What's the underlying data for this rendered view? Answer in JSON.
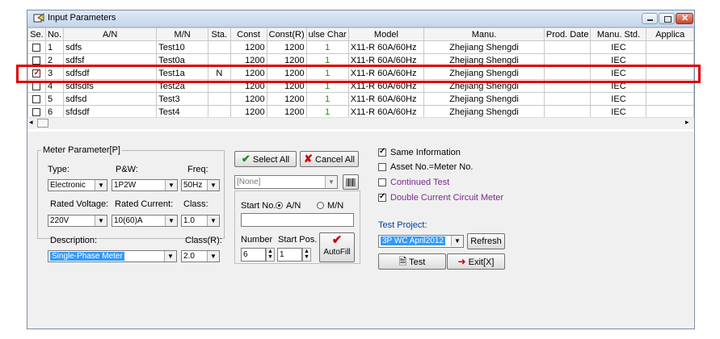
{
  "window": {
    "title": "Input Parameters"
  },
  "grid": {
    "headers": [
      "Se.",
      "No.",
      "A/N",
      "M/N",
      "Sta.",
      "Const",
      "Const(R)",
      "ulse Char",
      "Model",
      "Manu.",
      "Prod. Date",
      "Manu. Std.",
      "Applica"
    ],
    "rows": [
      {
        "checked": false,
        "no": "1",
        "an": "sdfs",
        "mn": "Test10",
        "sta": "",
        "const": "1200",
        "constr": "1200",
        "pulse": "1",
        "model": "X11-R 60A/60Hz",
        "manu": "Zhejiang Shengdi",
        "prod": "",
        "std": "IEC",
        "app": ""
      },
      {
        "checked": false,
        "no": "2",
        "an": "sdfsf",
        "mn": "Test0a",
        "sta": "",
        "const": "1200",
        "constr": "1200",
        "pulse": "1",
        "model": "X11-R 60A/60Hz",
        "manu": "Zhejiang Shengdi",
        "prod": "",
        "std": "IEC",
        "app": ""
      },
      {
        "checked": true,
        "no": "3",
        "an": "sdfsdf",
        "mn": "Test1a",
        "sta": "N",
        "const": "1200",
        "constr": "1200",
        "pulse": "1",
        "model": "X11-R 60A/60Hz",
        "manu": "Zhejiang Shengdi",
        "prod": "",
        "std": "IEC",
        "app": ""
      },
      {
        "checked": false,
        "no": "4",
        "an": "sdfsdfs",
        "mn": "Test2a",
        "sta": "",
        "const": "1200",
        "constr": "1200",
        "pulse": "1",
        "model": "X11-R 60A/60Hz",
        "manu": "Zhejiang Shengdi",
        "prod": "",
        "std": "IEC",
        "app": ""
      },
      {
        "checked": false,
        "no": "5",
        "an": "sdfsd",
        "mn": "Test3",
        "sta": "",
        "const": "1200",
        "constr": "1200",
        "pulse": "1",
        "model": "X11-R 60A/60Hz",
        "manu": "Zhejiang Shengdi",
        "prod": "",
        "std": "IEC",
        "app": ""
      },
      {
        "checked": false,
        "no": "6",
        "an": "sfdsdf",
        "mn": "Test4",
        "sta": "",
        "const": "1200",
        "constr": "1200",
        "pulse": "1",
        "model": "X11-R 60A/60Hz",
        "manu": "Zhejiang Shengdi",
        "prod": "",
        "std": "IEC",
        "app": ""
      }
    ],
    "scroll_left": "◂",
    "scroll_right": "▸"
  },
  "meter": {
    "group_title": "Meter Parameter[P]",
    "type_label": "Type:",
    "type_value": "Electronic",
    "pw_label": "P&W:",
    "pw_value": "1P2W",
    "freq_label": "Freq:",
    "freq_value": "50Hz",
    "voltage_label": "Rated Voltage:",
    "voltage_value": "220V",
    "current_label": "Rated Current:",
    "current_value": "10(60)A",
    "class_label": "Class:",
    "class_value": "1.0",
    "desc_label": "Description:",
    "desc_value": "Single-Phase Meter",
    "classr_label": "Class(R):",
    "classr_value": "2.0"
  },
  "mid": {
    "select_all": "Select All",
    "cancel_all": "Cancel All",
    "none_value": "[None]",
    "start_no_label": "Start No.:",
    "radio_an": "A/N",
    "radio_mn": "M/N",
    "number_label": "Number",
    "startpos_label": "Start Pos.",
    "number_value": "6",
    "startpos_value": "1",
    "autofill": "AutoFill"
  },
  "options": {
    "same_info": "Same Information",
    "asset_no": "Asset No.=Meter No.",
    "continued": "Continued Test",
    "double_current": "Double Current Circuit Meter",
    "test_project_label": "Test Project:",
    "test_project_value": "3P WC April2012",
    "refresh": "Refresh",
    "test": "Test",
    "exit": "Exit[X]"
  },
  "colors": {
    "accent": "#3399ff",
    "highlight_red": "#e00000",
    "pulse_green": "#1a8c1a"
  }
}
